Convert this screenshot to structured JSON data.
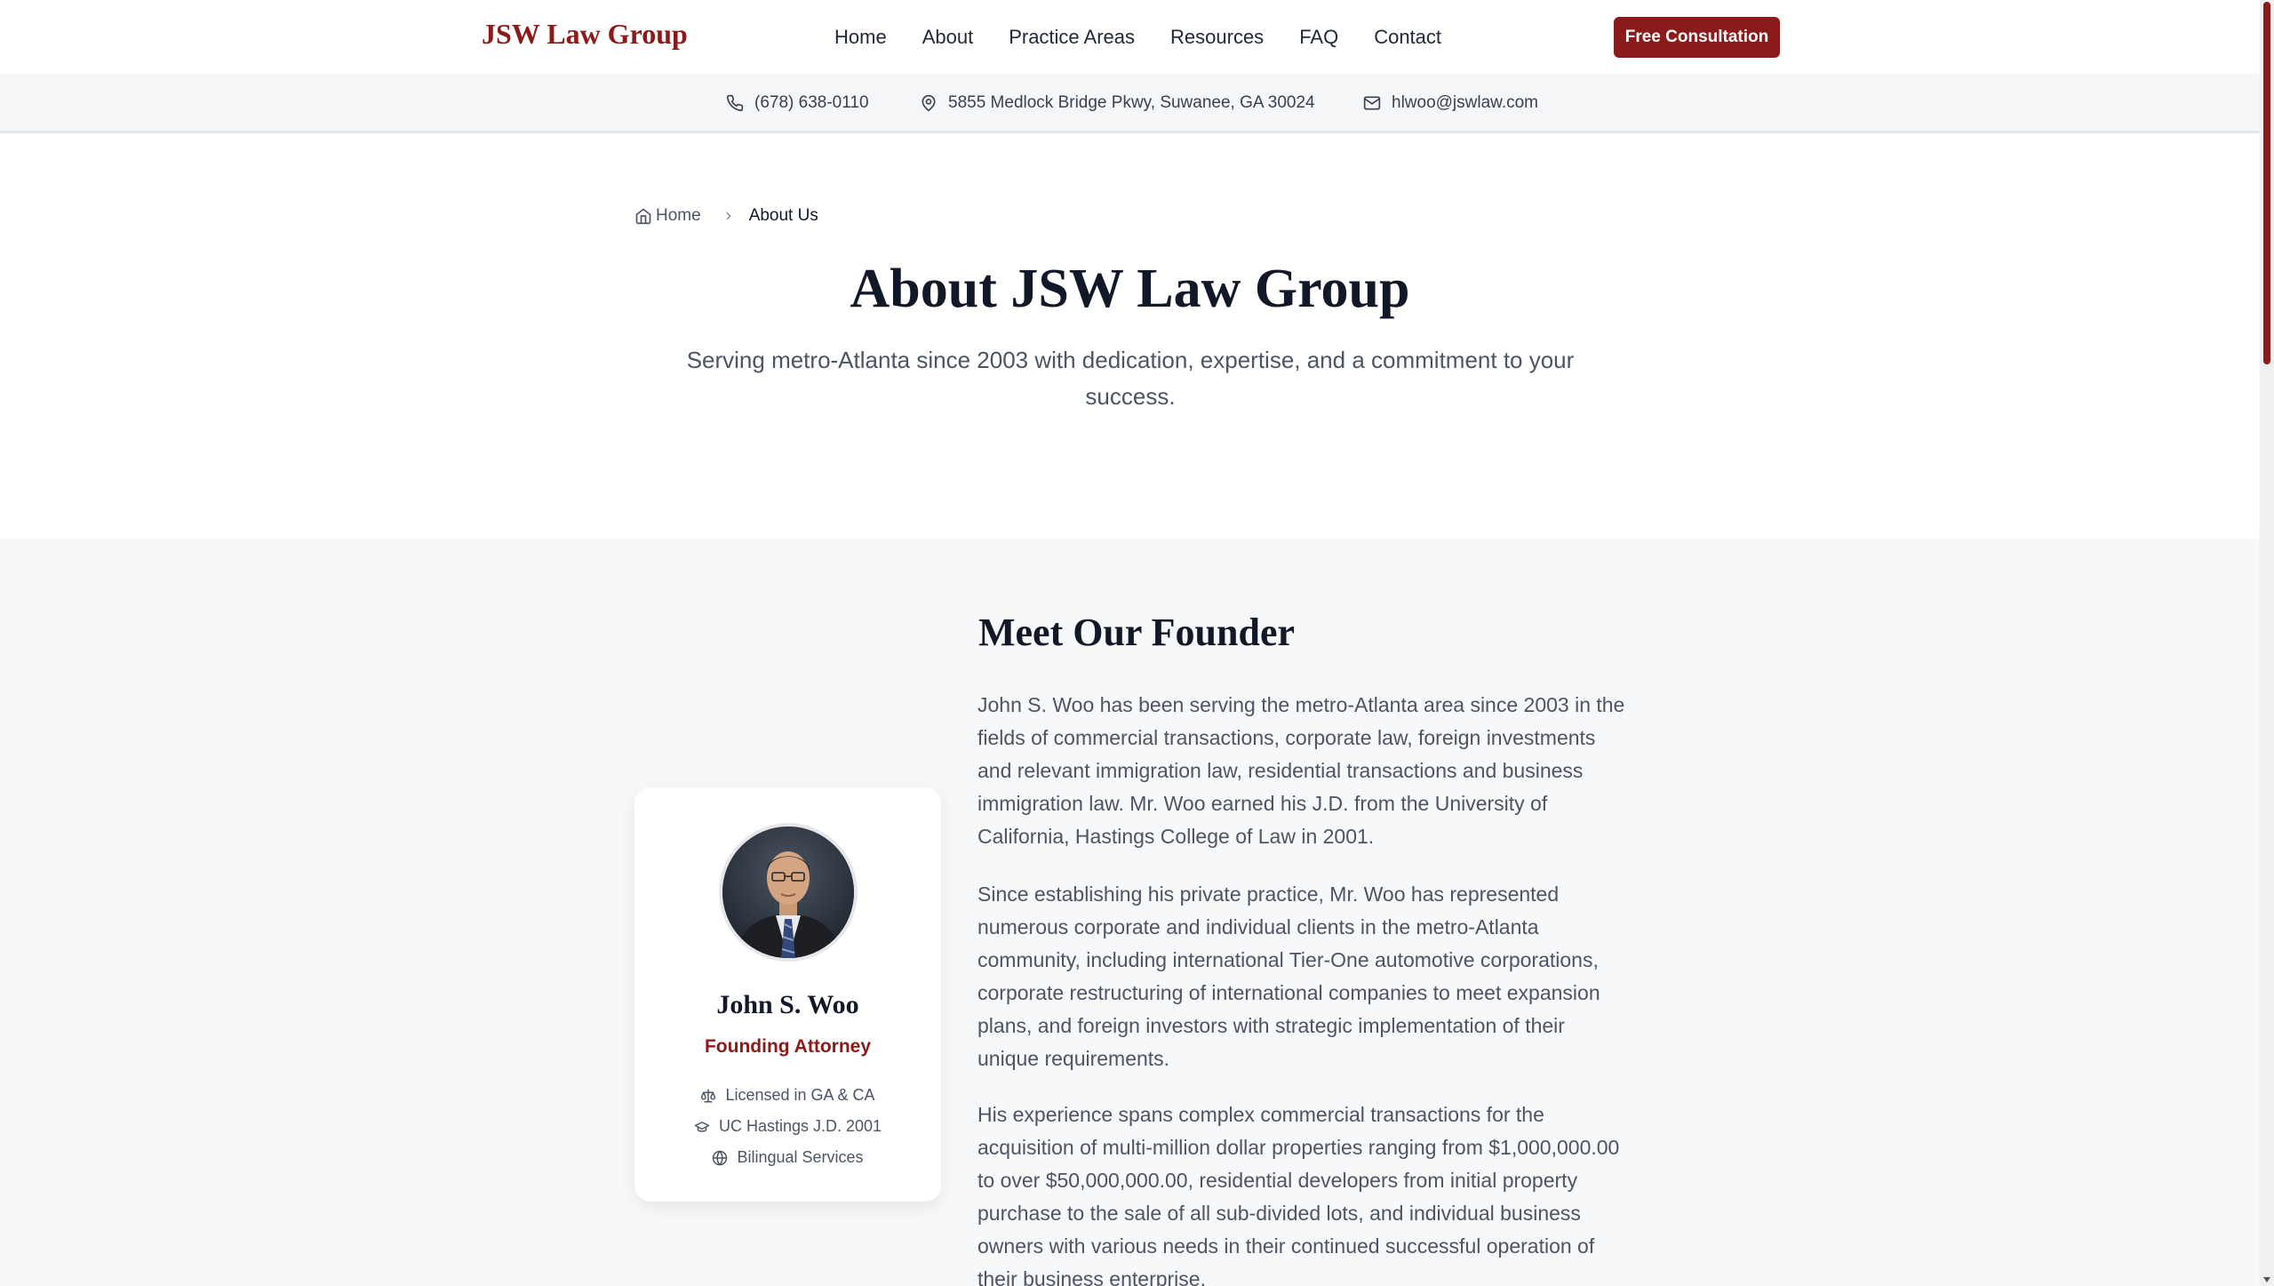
{
  "header": {
    "logo": "JSW Law Group",
    "nav": [
      {
        "label": "Home"
      },
      {
        "label": "About"
      },
      {
        "label": "Practice Areas"
      },
      {
        "label": "Resources"
      },
      {
        "label": "FAQ"
      },
      {
        "label": "Contact"
      }
    ],
    "cta_label": "Free Consultation"
  },
  "infobar": {
    "phone": "(678) 638-0110",
    "address": "5855 Medlock Bridge Pkwy, Suwanee, GA 30024",
    "email": "hlwoo@jswlaw.com"
  },
  "breadcrumb": {
    "home": "Home",
    "current": "About Us"
  },
  "hero": {
    "title": "About JSW Law Group",
    "subtitle": "Serving metro-Atlanta since 2003 with dedication, expertise, and a commitment to your success."
  },
  "founder_card": {
    "name": "John S. Woo",
    "role": "Founding Attorney",
    "credentials": [
      {
        "icon": "scale-icon",
        "label": "Licensed in GA & CA"
      },
      {
        "icon": "graduation-cap-icon",
        "label": "UC Hastings J.D. 2001"
      },
      {
        "icon": "globe-icon",
        "label": "Bilingual Services"
      }
    ]
  },
  "founder_section": {
    "title": "Meet Our Founder",
    "paragraphs": [
      "John S. Woo has been serving the metro-Atlanta area since 2003 in the fields of commercial transactions, corporate law, foreign investments and relevant immigration law, residential transactions and business immigration law. Mr. Woo earned his J.D. from the University of California, Hastings College of Law in 2001.",
      "Since establishing his private practice, Mr. Woo has represented numerous corporate and individual clients in the metro-Atlanta community, including international Tier-One automotive corporations, corporate restructuring of international companies to meet expansion plans, and foreign investors with strategic implementation of their unique requirements.",
      "His experience spans complex commercial transactions for the acquisition of multi-million dollar properties ranging from $1,000,000.00 to over $50,000,000.00, residential developers from initial property purchase to the sale of all sub-divided lots, and individual business owners with various needs in their continued successful operation of their business enterprise."
    ]
  },
  "colors": {
    "brand": "#8b1a1a",
    "heading": "#111827",
    "body_text": "#4b5563",
    "section_bg": "#f7f8fa"
  }
}
